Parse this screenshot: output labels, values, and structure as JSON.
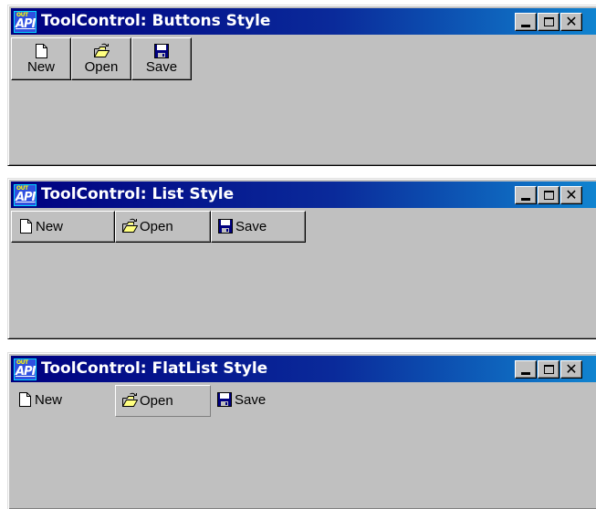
{
  "windows": [
    {
      "title": "ToolControl: Buttons Style",
      "style": "buttons",
      "buttons": [
        {
          "label": "New",
          "icon": "new-document-icon"
        },
        {
          "label": "Open",
          "icon": "open-folder-icon"
        },
        {
          "label": "Save",
          "icon": "floppy-disk-icon"
        }
      ]
    },
    {
      "title": "ToolControl: List Style",
      "style": "list",
      "buttons": [
        {
          "label": "New",
          "icon": "new-document-icon"
        },
        {
          "label": "Open",
          "icon": "open-folder-icon"
        },
        {
          "label": "Save",
          "icon": "floppy-disk-icon"
        }
      ]
    },
    {
      "title": "ToolControl: FlatList Style",
      "style": "flatlist",
      "buttons": [
        {
          "label": "New",
          "icon": "new-document-icon"
        },
        {
          "label": "Open",
          "icon": "open-folder-icon"
        },
        {
          "label": "Save",
          "icon": "floppy-disk-icon"
        }
      ]
    }
  ],
  "window_controls": {
    "minimize": "minimize-icon",
    "maximize": "maximize-icon",
    "close": "close-icon"
  },
  "app_icon": {
    "text_top": "OUT",
    "text_main": "API"
  },
  "colors": {
    "title_start": "#000080",
    "title_end": "#1084d0",
    "face": "#c0c0c0",
    "folder": "#ffff80",
    "floppy": "#000080"
  }
}
